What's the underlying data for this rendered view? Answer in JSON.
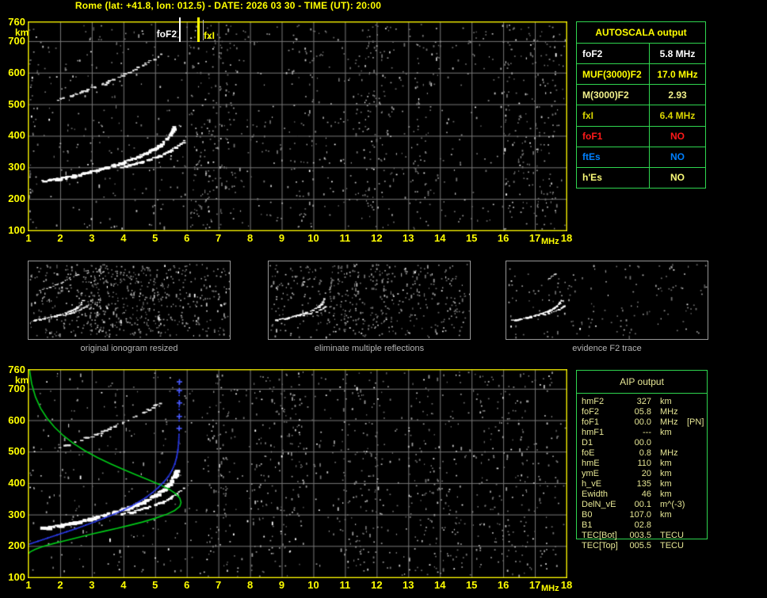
{
  "title": "Rome (lat: +41.8, lon: 012.5) - DATE: 2026 03 30 - TIME (UT): 20:00",
  "colors": {
    "background": "#000000",
    "title_yellow": "#ffff00",
    "plot_border": "#ddd800",
    "grid": "#787878",
    "table_border_green": "#2fd54f",
    "aip_text": "#e6e695",
    "trace_white": "#ffffff",
    "profile_green": "#00cb18",
    "fit_blue": "#2b3cf0",
    "status_red": "#ff1a1a",
    "status_blue": "#0080ff",
    "caption_gray": "#b5b5b5"
  },
  "autoscala": {
    "header": "AUTOSCALA output",
    "rows": [
      {
        "label": "foF2",
        "value": "5.8 MHz",
        "color": "#ffffff"
      },
      {
        "label": "MUF(3000)F2",
        "value": "17.0 MHz",
        "color": "#ffff00"
      },
      {
        "label": "M(3000)F2",
        "value": "2.93",
        "color": "#f2f18c"
      },
      {
        "label": "fxI",
        "value": "6.4 MHz",
        "color": "#d9d500"
      },
      {
        "label": "foF1",
        "value": "NO",
        "color": "#ff1a1a"
      },
      {
        "label": "ftEs",
        "value": "NO",
        "color": "#0080ff"
      },
      {
        "label": "h'Es",
        "value": "NO",
        "color": "#fafa78"
      }
    ]
  },
  "aip": {
    "header": "AIP output",
    "rows": [
      {
        "label": "hmF2",
        "value": "327",
        "unit": "km",
        "note": ""
      },
      {
        "label": "foF2",
        "value": "05.8",
        "unit": "MHz",
        "note": ""
      },
      {
        "label": "foF1",
        "value": "00.0",
        "unit": "MHz",
        "note": "[PN]"
      },
      {
        "label": "hmF1",
        "value": "---",
        "unit": "km",
        "note": ""
      },
      {
        "label": "D1",
        "value": "00.0",
        "unit": "",
        "note": ""
      },
      {
        "label": "foE",
        "value": "0.8",
        "unit": "MHz",
        "note": ""
      },
      {
        "label": "hmE",
        "value": "110",
        "unit": "km",
        "note": ""
      },
      {
        "label": "ymE",
        "value": "20",
        "unit": "km",
        "note": ""
      },
      {
        "label": "h_vE",
        "value": "135",
        "unit": "km",
        "note": ""
      },
      {
        "label": "Ewidth",
        "value": "46",
        "unit": "km",
        "note": ""
      },
      {
        "label": "DelN_vE",
        "value": "00.1",
        "unit": "m^(-3)",
        "note": ""
      },
      {
        "label": "B0",
        "value": "107.0",
        "unit": "km",
        "note": ""
      },
      {
        "label": "B1",
        "value": "02.8",
        "unit": "",
        "note": ""
      },
      {
        "label": "TEC[Bot]",
        "value": "003.5",
        "unit": "TECU",
        "note": ""
      },
      {
        "label": "TEC[Top]",
        "value": "005.5",
        "unit": "TECU",
        "note": ""
      }
    ]
  },
  "panel_captions": [
    "original ionogram resized",
    "eliminate multiple reflections",
    "evidence F2 trace"
  ],
  "chart_data": [
    {
      "id": "scaled-ionogram",
      "type": "scatter",
      "title": "",
      "xlabel": "MHz",
      "ylabel": "km",
      "xlim": [
        1,
        18
      ],
      "ylim": [
        100,
        760
      ],
      "x_ticks": [
        1,
        2,
        3,
        4,
        5,
        6,
        7,
        8,
        9,
        10,
        11,
        12,
        13,
        14,
        15,
        16,
        17,
        18
      ],
      "y_ticks": [
        760,
        700,
        600,
        500,
        400,
        300,
        200,
        100
      ],
      "grid": true,
      "markers": [
        {
          "label": "foF2",
          "x": 5.8,
          "color": "#ffffff"
        },
        {
          "label": "fxI",
          "x": 6.4,
          "color": "#ffff00"
        }
      ],
      "series": [
        {
          "name": "F2 O-mode trace",
          "color": "#ffffff",
          "points": [
            [
              1.45,
              256
            ],
            [
              1.7,
              259
            ],
            [
              1.95,
              263
            ],
            [
              2.2,
              268
            ],
            [
              2.45,
              273
            ],
            [
              2.7,
              279
            ],
            [
              2.95,
              285
            ],
            [
              3.2,
              291
            ],
            [
              3.45,
              298
            ],
            [
              3.7,
              305
            ],
            [
              3.95,
              313
            ],
            [
              4.2,
              322
            ],
            [
              4.45,
              332
            ],
            [
              4.7,
              343
            ],
            [
              4.95,
              356
            ],
            [
              5.15,
              369
            ],
            [
              5.3,
              381
            ],
            [
              5.45,
              396
            ],
            [
              5.55,
              411
            ],
            [
              5.63,
              426
            ],
            [
              5.7,
              440
            ]
          ]
        },
        {
          "name": "F2 X-mode branch",
          "color": "#ffffff",
          "points": [
            [
              3.95,
              300
            ],
            [
              4.25,
              307
            ],
            [
              4.55,
              315
            ],
            [
              4.85,
              325
            ],
            [
              5.15,
              336
            ],
            [
              5.45,
              350
            ],
            [
              5.65,
              362
            ],
            [
              5.82,
              374
            ],
            [
              5.93,
              383
            ]
          ]
        },
        {
          "name": "second-hop echo",
          "color": "#e8e8e8",
          "points": [
            [
              1.9,
              512
            ],
            [
              2.2,
              521
            ],
            [
              2.5,
              531
            ],
            [
              2.8,
              542
            ],
            [
              3.1,
              553
            ],
            [
              3.4,
              565
            ],
            [
              3.7,
              578
            ],
            [
              4.0,
              592
            ],
            [
              4.3,
              606
            ],
            [
              4.55,
              619
            ],
            [
              4.8,
              632
            ],
            [
              5.0,
              645
            ],
            [
              5.2,
              659
            ]
          ]
        }
      ],
      "noise": {
        "seed": 7,
        "count": 780,
        "bands": [
          [
            1.0,
            1.15,
            25
          ],
          [
            6.05,
            7.55,
            150
          ],
          [
            9.2,
            10.0,
            45
          ],
          [
            11.3,
            12.6,
            95
          ],
          [
            13.2,
            13.6,
            30
          ],
          [
            15.9,
            17.7,
            150
          ]
        ]
      }
    },
    {
      "id": "profile-ionogram",
      "type": "scatter",
      "title": "",
      "xlabel": "MHz",
      "ylabel": "km",
      "xlim": [
        1,
        18
      ],
      "ylim": [
        100,
        760
      ],
      "x_ticks": [
        1,
        2,
        3,
        4,
        5,
        6,
        7,
        8,
        9,
        10,
        11,
        12,
        13,
        14,
        15,
        16,
        17,
        18
      ],
      "y_ticks": [
        760,
        700,
        600,
        500,
        400,
        300,
        200,
        100
      ],
      "grid": true,
      "series": [
        {
          "name": "F2 O-mode trace",
          "color": "#ffffff",
          "points": [
            [
              1.45,
              256
            ],
            [
              1.7,
              259
            ],
            [
              1.95,
              263
            ],
            [
              2.2,
              268
            ],
            [
              2.45,
              273
            ],
            [
              2.7,
              279
            ],
            [
              2.95,
              285
            ],
            [
              3.2,
              291
            ],
            [
              3.45,
              298
            ],
            [
              3.7,
              305
            ],
            [
              3.95,
              313
            ],
            [
              4.2,
              322
            ],
            [
              4.45,
              332
            ],
            [
              4.7,
              343
            ],
            [
              4.95,
              356
            ],
            [
              5.15,
              369
            ],
            [
              5.3,
              381
            ],
            [
              5.45,
              396
            ],
            [
              5.55,
              411
            ],
            [
              5.63,
              426
            ],
            [
              5.7,
              440
            ]
          ]
        },
        {
          "name": "F2 X-mode branch",
          "color": "#ffffff",
          "points": [
            [
              3.95,
              300
            ],
            [
              4.25,
              307
            ],
            [
              4.55,
              315
            ],
            [
              4.85,
              325
            ],
            [
              5.15,
              336
            ],
            [
              5.45,
              350
            ],
            [
              5.65,
              362
            ],
            [
              5.82,
              374
            ],
            [
              5.93,
              383
            ]
          ]
        },
        {
          "name": "second-hop echo",
          "color": "#e8e8e8",
          "points": [
            [
              1.9,
              512
            ],
            [
              2.2,
              521
            ],
            [
              2.5,
              531
            ],
            [
              2.8,
              542
            ],
            [
              3.1,
              553
            ],
            [
              3.4,
              565
            ],
            [
              3.7,
              578
            ],
            [
              4.0,
              592
            ],
            [
              4.3,
              606
            ],
            [
              4.55,
              619
            ],
            [
              4.8,
              632
            ],
            [
              5.0,
              645
            ],
            [
              5.2,
              659
            ]
          ]
        },
        {
          "name": "electron density profile (AIP)",
          "color": "#00cb18",
          "points": [
            [
              1.03,
              760
            ],
            [
              1.1,
              716
            ],
            [
              1.22,
              674
            ],
            [
              1.38,
              638
            ],
            [
              1.58,
              607
            ],
            [
              1.82,
              578
            ],
            [
              2.1,
              551
            ],
            [
              2.42,
              526
            ],
            [
              2.78,
              503
            ],
            [
              3.18,
              481
            ],
            [
              3.6,
              461
            ],
            [
              4.0,
              443
            ],
            [
              4.4,
              426
            ],
            [
              4.8,
              410
            ],
            [
              5.15,
              395
            ],
            [
              5.45,
              380
            ],
            [
              5.65,
              366
            ],
            [
              5.78,
              352
            ],
            [
              5.82,
              338
            ],
            [
              5.78,
              326
            ],
            [
              5.62,
              313
            ],
            [
              5.35,
              300
            ],
            [
              5.0,
              288
            ],
            [
              4.6,
              276
            ],
            [
              4.2,
              266
            ],
            [
              3.8,
              256
            ],
            [
              3.4,
              247
            ],
            [
              3.0,
              238
            ],
            [
              2.6,
              228
            ],
            [
              2.2,
              218
            ],
            [
              1.8,
              208
            ],
            [
              1.45,
              198
            ],
            [
              1.2,
              189
            ],
            [
              1.05,
              181
            ],
            [
              1.0,
              176
            ]
          ]
        },
        {
          "name": "fitted h'(f) trace",
          "color": "#2b3cf0",
          "points": [
            [
              1.03,
              206
            ],
            [
              1.3,
              215
            ],
            [
              1.6,
              225
            ],
            [
              1.9,
              235
            ],
            [
              2.2,
              245
            ],
            [
              2.5,
              255
            ],
            [
              2.8,
              266
            ],
            [
              3.1,
              277
            ],
            [
              3.4,
              289
            ],
            [
              3.7,
              301
            ],
            [
              4.0,
              314
            ],
            [
              4.25,
              327
            ],
            [
              4.5,
              341
            ],
            [
              4.72,
              355
            ],
            [
              4.92,
              370
            ],
            [
              5.1,
              386
            ],
            [
              5.27,
              403
            ],
            [
              5.42,
              421
            ],
            [
              5.53,
              440
            ],
            [
              5.62,
              460
            ],
            [
              5.68,
              482
            ],
            [
              5.72,
              505
            ],
            [
              5.745,
              530
            ],
            [
              5.755,
              555
            ]
          ],
          "plus_markers": [
            [
              5.76,
              574
            ],
            [
              5.765,
              612
            ],
            [
              5.77,
              655
            ],
            [
              5.765,
              694
            ],
            [
              5.77,
              722
            ]
          ],
          "asymptote_x": 5.76
        }
      ],
      "noise": {
        "seed": 13,
        "count": 680,
        "bands": [
          [
            6.6,
            7.3,
            70
          ],
          [
            8.0,
            9.7,
            120
          ],
          [
            10.9,
            12.2,
            90
          ],
          [
            13.0,
            14.7,
            100
          ],
          [
            15.1,
            17.7,
            150
          ]
        ]
      }
    },
    {
      "id": "mini-ionograms",
      "type": "scatter",
      "xlim": [
        1,
        18
      ],
      "ylim": [
        100,
        760
      ],
      "panels": [
        {
          "caption": "original ionogram resized",
          "show_second_hop": true,
          "hop_slice": [
            0,
            13
          ],
          "noise_count": 520,
          "bands": [
            [
              6.0,
              8.5,
              90
            ],
            [
              9.5,
              12.0,
              60
            ]
          ]
        },
        {
          "caption": "eliminate multiple reflections",
          "show_second_hop": true,
          "hop_slice": [
            6,
            11
          ],
          "noise_count": 430,
          "bands": [
            [
              6.0,
              8.5,
              60
            ]
          ]
        },
        {
          "caption": "evidence F2 trace",
          "show_second_hop": true,
          "hop_slice": [
            8,
            13
          ],
          "noise_count": 160,
          "bands": []
        }
      ]
    }
  ]
}
